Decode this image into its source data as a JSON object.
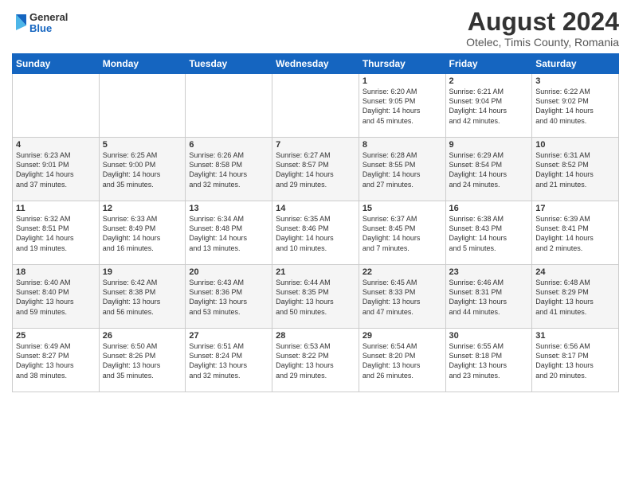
{
  "logo": {
    "line1": "General",
    "line2": "Blue"
  },
  "title": {
    "month_year": "August 2024",
    "location": "Otelec, Timis County, Romania"
  },
  "weekdays": [
    "Sunday",
    "Monday",
    "Tuesday",
    "Wednesday",
    "Thursday",
    "Friday",
    "Saturday"
  ],
  "weeks": [
    [
      {
        "day": "",
        "info": ""
      },
      {
        "day": "",
        "info": ""
      },
      {
        "day": "",
        "info": ""
      },
      {
        "day": "",
        "info": ""
      },
      {
        "day": "1",
        "info": "Sunrise: 6:20 AM\nSunset: 9:05 PM\nDaylight: 14 hours\nand 45 minutes."
      },
      {
        "day": "2",
        "info": "Sunrise: 6:21 AM\nSunset: 9:04 PM\nDaylight: 14 hours\nand 42 minutes."
      },
      {
        "day": "3",
        "info": "Sunrise: 6:22 AM\nSunset: 9:02 PM\nDaylight: 14 hours\nand 40 minutes."
      }
    ],
    [
      {
        "day": "4",
        "info": "Sunrise: 6:23 AM\nSunset: 9:01 PM\nDaylight: 14 hours\nand 37 minutes."
      },
      {
        "day": "5",
        "info": "Sunrise: 6:25 AM\nSunset: 9:00 PM\nDaylight: 14 hours\nand 35 minutes."
      },
      {
        "day": "6",
        "info": "Sunrise: 6:26 AM\nSunset: 8:58 PM\nDaylight: 14 hours\nand 32 minutes."
      },
      {
        "day": "7",
        "info": "Sunrise: 6:27 AM\nSunset: 8:57 PM\nDaylight: 14 hours\nand 29 minutes."
      },
      {
        "day": "8",
        "info": "Sunrise: 6:28 AM\nSunset: 8:55 PM\nDaylight: 14 hours\nand 27 minutes."
      },
      {
        "day": "9",
        "info": "Sunrise: 6:29 AM\nSunset: 8:54 PM\nDaylight: 14 hours\nand 24 minutes."
      },
      {
        "day": "10",
        "info": "Sunrise: 6:31 AM\nSunset: 8:52 PM\nDaylight: 14 hours\nand 21 minutes."
      }
    ],
    [
      {
        "day": "11",
        "info": "Sunrise: 6:32 AM\nSunset: 8:51 PM\nDaylight: 14 hours\nand 19 minutes."
      },
      {
        "day": "12",
        "info": "Sunrise: 6:33 AM\nSunset: 8:49 PM\nDaylight: 14 hours\nand 16 minutes."
      },
      {
        "day": "13",
        "info": "Sunrise: 6:34 AM\nSunset: 8:48 PM\nDaylight: 14 hours\nand 13 minutes."
      },
      {
        "day": "14",
        "info": "Sunrise: 6:35 AM\nSunset: 8:46 PM\nDaylight: 14 hours\nand 10 minutes."
      },
      {
        "day": "15",
        "info": "Sunrise: 6:37 AM\nSunset: 8:45 PM\nDaylight: 14 hours\nand 7 minutes."
      },
      {
        "day": "16",
        "info": "Sunrise: 6:38 AM\nSunset: 8:43 PM\nDaylight: 14 hours\nand 5 minutes."
      },
      {
        "day": "17",
        "info": "Sunrise: 6:39 AM\nSunset: 8:41 PM\nDaylight: 14 hours\nand 2 minutes."
      }
    ],
    [
      {
        "day": "18",
        "info": "Sunrise: 6:40 AM\nSunset: 8:40 PM\nDaylight: 13 hours\nand 59 minutes."
      },
      {
        "day": "19",
        "info": "Sunrise: 6:42 AM\nSunset: 8:38 PM\nDaylight: 13 hours\nand 56 minutes."
      },
      {
        "day": "20",
        "info": "Sunrise: 6:43 AM\nSunset: 8:36 PM\nDaylight: 13 hours\nand 53 minutes."
      },
      {
        "day": "21",
        "info": "Sunrise: 6:44 AM\nSunset: 8:35 PM\nDaylight: 13 hours\nand 50 minutes."
      },
      {
        "day": "22",
        "info": "Sunrise: 6:45 AM\nSunset: 8:33 PM\nDaylight: 13 hours\nand 47 minutes."
      },
      {
        "day": "23",
        "info": "Sunrise: 6:46 AM\nSunset: 8:31 PM\nDaylight: 13 hours\nand 44 minutes."
      },
      {
        "day": "24",
        "info": "Sunrise: 6:48 AM\nSunset: 8:29 PM\nDaylight: 13 hours\nand 41 minutes."
      }
    ],
    [
      {
        "day": "25",
        "info": "Sunrise: 6:49 AM\nSunset: 8:27 PM\nDaylight: 13 hours\nand 38 minutes."
      },
      {
        "day": "26",
        "info": "Sunrise: 6:50 AM\nSunset: 8:26 PM\nDaylight: 13 hours\nand 35 minutes."
      },
      {
        "day": "27",
        "info": "Sunrise: 6:51 AM\nSunset: 8:24 PM\nDaylight: 13 hours\nand 32 minutes."
      },
      {
        "day": "28",
        "info": "Sunrise: 6:53 AM\nSunset: 8:22 PM\nDaylight: 13 hours\nand 29 minutes."
      },
      {
        "day": "29",
        "info": "Sunrise: 6:54 AM\nSunset: 8:20 PM\nDaylight: 13 hours\nand 26 minutes."
      },
      {
        "day": "30",
        "info": "Sunrise: 6:55 AM\nSunset: 8:18 PM\nDaylight: 13 hours\nand 23 minutes."
      },
      {
        "day": "31",
        "info": "Sunrise: 6:56 AM\nSunset: 8:17 PM\nDaylight: 13 hours\nand 20 minutes."
      }
    ]
  ]
}
